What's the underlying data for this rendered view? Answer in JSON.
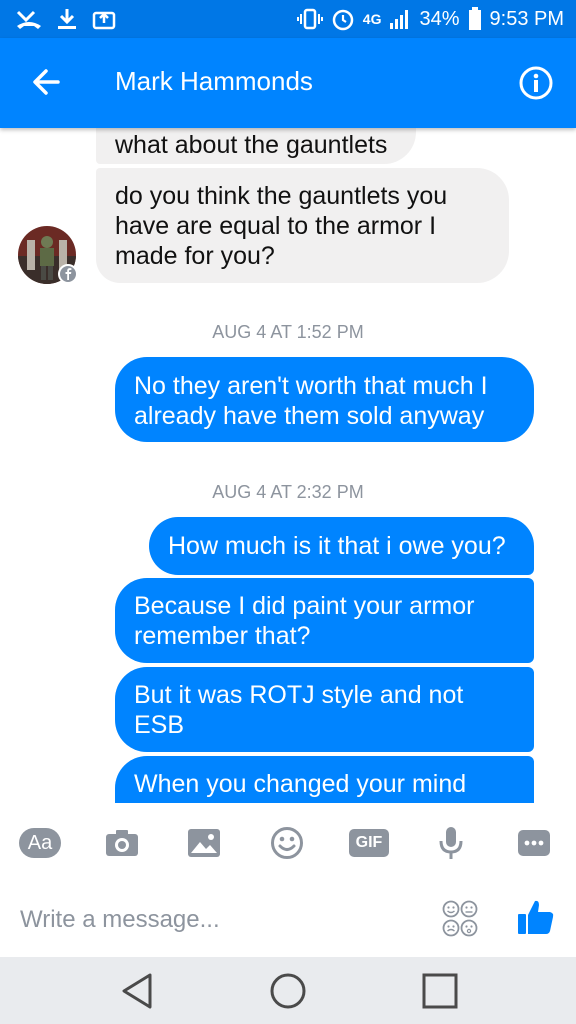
{
  "status_bar": {
    "network": "4G",
    "battery": "34%",
    "time": "9:53 PM"
  },
  "header": {
    "contact_name": "Mark Hammonds"
  },
  "messages": [
    {
      "type": "incoming",
      "text": "what about the gauntlets"
    },
    {
      "type": "incoming",
      "text": "do you think the gauntlets you have are equal to the armor I made for you?"
    },
    {
      "type": "timestamp",
      "text": "AUG 4 AT 1:52 PM"
    },
    {
      "type": "outgoing",
      "text": "No they aren't worth that much I already have them sold anyway"
    },
    {
      "type": "timestamp",
      "text": "AUG 4 AT 2:32 PM"
    },
    {
      "type": "outgoing",
      "text": "How much is it that i owe you?"
    },
    {
      "type": "outgoing",
      "text": "Because I did paint your armor remember that?"
    },
    {
      "type": "outgoing",
      "text": "But it was ROTJ style and not ESB"
    },
    {
      "type": "outgoing",
      "text": "When you changed your mind"
    }
  ],
  "toolbar": {
    "text_label": "Aa",
    "gif_label": "GIF"
  },
  "composer": {
    "placeholder": "Write a message..."
  },
  "colors": {
    "brand": "#0084ff",
    "incoming_bubble": "#f1f0f0",
    "icon_gray": "#8d949e"
  }
}
